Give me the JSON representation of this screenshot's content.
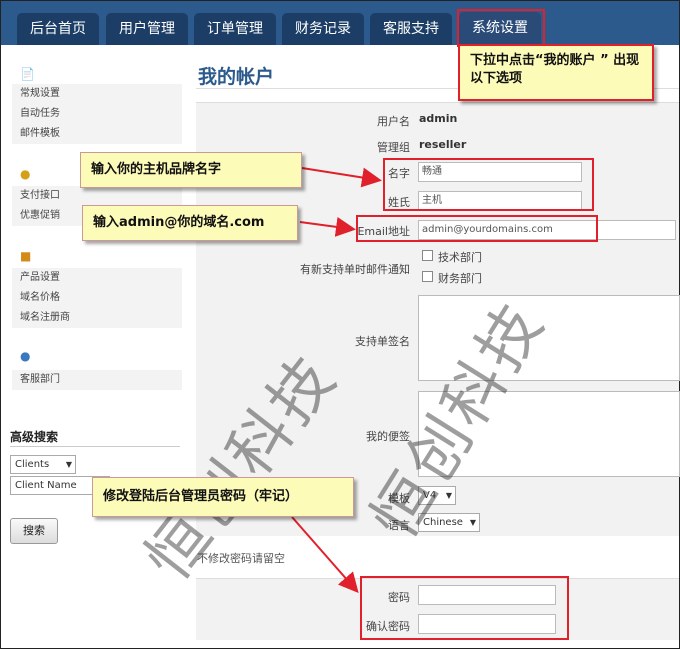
{
  "nav": {
    "tabs": [
      {
        "label": "后台首页"
      },
      {
        "label": "用户管理"
      },
      {
        "label": "订单管理"
      },
      {
        "label": "财务记录"
      },
      {
        "label": "客服支持"
      },
      {
        "label": "系统设置"
      }
    ]
  },
  "sidebar": {
    "groups": [
      {
        "items": [
          "常规设置",
          "自动任务",
          "邮件模板"
        ]
      },
      {
        "items": [
          "支付接口",
          "优惠促销"
        ]
      },
      {
        "items": [
          "产品设置",
          "域名价格",
          "域名注册商"
        ]
      },
      {
        "items": [
          "客服部门"
        ]
      }
    ],
    "advanced_search": {
      "title": "高级搜索",
      "select_value": "Clients",
      "input_value": "Client Name",
      "button_label": "搜索"
    }
  },
  "main": {
    "title": "我的帐户",
    "fields": {
      "username_label": "用户名",
      "username_value": "admin",
      "group_label": "管理组",
      "group_value": "reseller",
      "firstname_label": "名字",
      "firstname_value": "畅通",
      "lastname_label": "姓氏",
      "lastname_value": "主机",
      "email_label": "Email地址",
      "email_value": "admin@yourdomains.com",
      "notify_label": "有新支持单时邮件通知",
      "dept_1": "技术部门",
      "dept_2": "财务部门",
      "signature_label": "支持单签名",
      "notes_label": "我的便签",
      "template_label": "模板",
      "template_value": "V4",
      "language_label": "语言",
      "language_value": "Chinese"
    },
    "password_note": "不修改密码请留空",
    "password_label": "密码",
    "confirm_label": "确认密码"
  },
  "annotations": {
    "dropdown_hint": "下拉中点击“我的账户 ” 出现以下选项",
    "brand_hint": "输入你的主机品牌名字",
    "email_hint": "输入admin@你的域名.com",
    "password_hint": "修改登陆后台管理员密码（牢记）"
  },
  "watermark": "恒创科技",
  "colors": {
    "nav_bar": "#2c5a8c",
    "tab": "#1b3d66",
    "accent_red": "#e0202a",
    "callout_bg": "#fdfbb8",
    "title": "#2c5a8c"
  }
}
